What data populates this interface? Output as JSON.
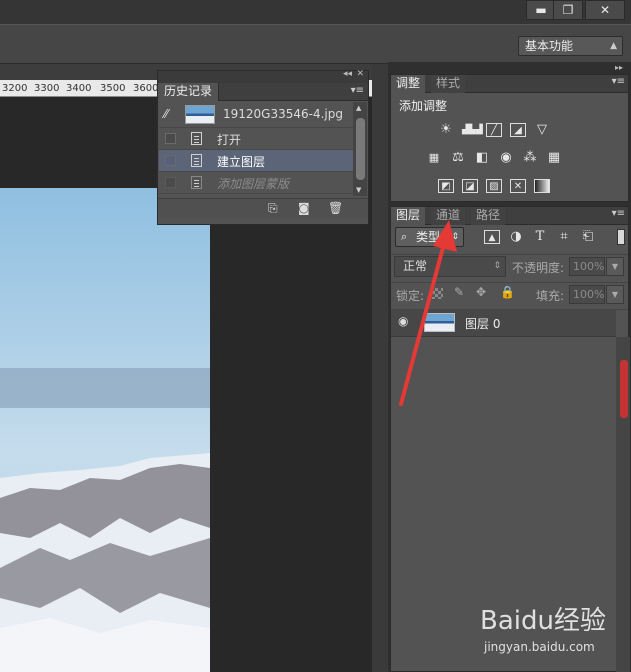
{
  "window": {
    "minimize": "▬",
    "restore": "❐",
    "close": "✕"
  },
  "options_bar": {
    "workspace": "基本功能"
  },
  "ruler": {
    "ticks": [
      "3200",
      "3300",
      "3400",
      "3500",
      "3600"
    ]
  },
  "history_panel": {
    "tab": "历史记录",
    "snapshot_name": "19120G33546-4.jpg",
    "items": [
      {
        "label": "打开",
        "state": "normal"
      },
      {
        "label": "建立图层",
        "state": "selected"
      },
      {
        "label": "添加图层蒙版",
        "state": "greyed"
      }
    ]
  },
  "adjustments_panel": {
    "tabs": [
      "调整",
      "样式"
    ],
    "title": "添加调整"
  },
  "layers_panel": {
    "tabs": [
      "图层",
      "通道",
      "路径"
    ],
    "filter": "类型",
    "blend_mode": "正常",
    "opacity_label": "不透明度:",
    "opacity_value": "100%",
    "lock_label": "锁定:",
    "fill_label": "填充:",
    "fill_value": "100%",
    "layers": [
      {
        "name": "图层 0",
        "visible": true
      }
    ]
  },
  "watermark": {
    "brand": "Baidu经验",
    "url": "jingyan.baidu.com"
  },
  "colors": {
    "accent_red": "#e53935",
    "panel": "#535353",
    "selected_row": "#5b6577"
  }
}
